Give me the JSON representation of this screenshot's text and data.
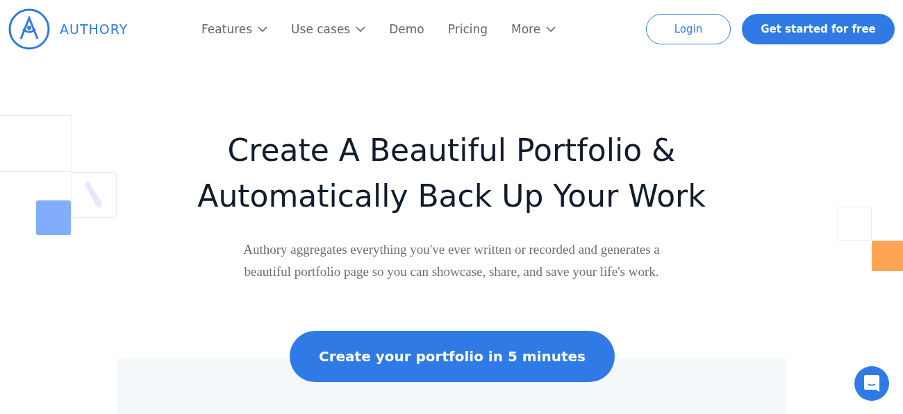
{
  "brand": {
    "name": "AUTHORY"
  },
  "nav": [
    {
      "label": "Features",
      "has_menu": true
    },
    {
      "label": "Use cases",
      "has_menu": true
    },
    {
      "label": "Demo",
      "has_menu": false
    },
    {
      "label": "Pricing",
      "has_menu": false
    },
    {
      "label": "More",
      "has_menu": true
    }
  ],
  "actions": {
    "login": "Login",
    "signup": "Get started for free"
  },
  "hero": {
    "title_lines": [
      "Create A Beautiful Portfolio &",
      "Automatically Back Up Your Work"
    ],
    "subtitle_lines": [
      "Authory aggregates everything you've ever written or recorded and generates a",
      "beautiful portfolio page so you can showcase, share, and save your life's work."
    ],
    "cta": "Create your portfolio in 5 minutes"
  }
}
